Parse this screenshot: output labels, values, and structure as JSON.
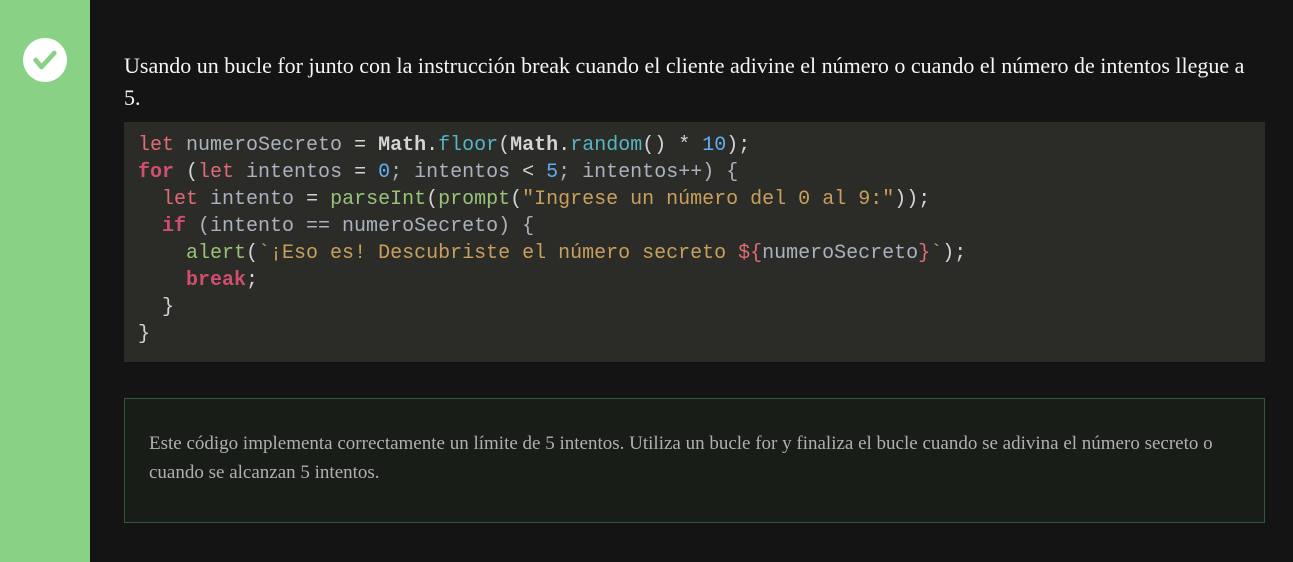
{
  "status": "correct",
  "description": "Usando un bucle for junto con la instrucción break cuando el cliente adivine el número o cuando el número de intentos llegue a 5.",
  "code": {
    "line1": {
      "kw_let": "let",
      "var1": "numeroSecreto",
      "eq": "=",
      "cls": "Math",
      "dot1": ".",
      "m_floor": "floor",
      "op_paren": "(",
      "cls2": "Math",
      "dot2": ".",
      "m_random": "random",
      "parens_empty": "()",
      "mul": " * ",
      "ten": "10",
      "close": ");"
    },
    "line2": {
      "kw_for": "for",
      "open": " (",
      "kw_let": "let",
      "var_i": " intentos ",
      "eq": "= ",
      "zero": "0",
      "semi1": "; intentos ",
      "lt": "< ",
      "five": "5",
      "semi2": "; intentos++) {"
    },
    "line3": {
      "indent": "  ",
      "kw_let": "let",
      "var_intent": " intento ",
      "eq": "= ",
      "fn_parseInt": "parseInt",
      "open": "(",
      "fn_prompt": "prompt",
      "open2": "(",
      "str": "\"Ingrese un número del 0 al 9:\"",
      "close": "));"
    },
    "line4": {
      "indent": "  ",
      "kw_if": "if",
      "cond": " (intento == numeroSecreto) {"
    },
    "line5": {
      "indent": "    ",
      "fn_alert": "alert",
      "open": "(",
      "tmpl_open": "`¡Eso es! Descubriste el número secreto ",
      "expr_open": "${",
      "expr_var": "numeroSecreto",
      "expr_close": "}",
      "tmpl_close": "`",
      "close": ");"
    },
    "line6": {
      "indent": "    ",
      "kw_break": "break",
      "semi": ";"
    },
    "line7": {
      "indent": "  ",
      "brace": "}"
    },
    "line8": {
      "brace": "}"
    }
  },
  "feedback": "Este código implementa correctamente un límite de 5 intentos. Utiliza un bucle for y finaliza el bucle cuando se adivina el número secreto o cuando se alcanzan 5 intentos."
}
